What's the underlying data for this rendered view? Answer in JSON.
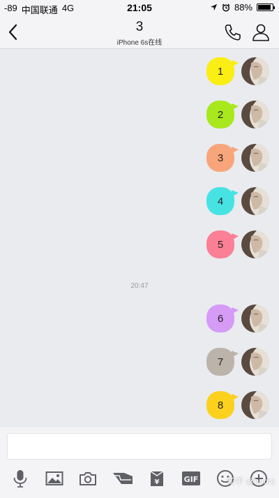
{
  "status_bar": {
    "signal": "-89",
    "carrier": "中国联通",
    "network": "4G",
    "time": "21:05",
    "battery": "88%",
    "battery_level": 0.88
  },
  "header": {
    "title": "3",
    "subtitle": "iPhone 6s在线"
  },
  "messages": [
    {
      "text": "1",
      "color": "#fbee14"
    },
    {
      "text": "2",
      "color": "#a8e81c"
    },
    {
      "text": "3",
      "color": "#f9a57c"
    },
    {
      "text": "4",
      "color": "#47e3e3"
    },
    {
      "text": "5",
      "color": "#fb7f95"
    },
    {
      "text": "6",
      "color": "#d69af7"
    },
    {
      "text": "7",
      "color": "#bcb3ab"
    },
    {
      "text": "8",
      "color": "#fbd11e"
    }
  ],
  "timestamp": "20:47",
  "input": {
    "placeholder": ""
  },
  "toolbar": {
    "items": [
      "microphone-icon",
      "image-icon",
      "camera-icon",
      "shake-icon",
      "red-packet-icon",
      "gif-icon",
      "emoji-icon",
      "plus-icon"
    ],
    "gif_label": "GIF",
    "yuan_label": "¥"
  },
  "watermark": "知乎 @huohj"
}
